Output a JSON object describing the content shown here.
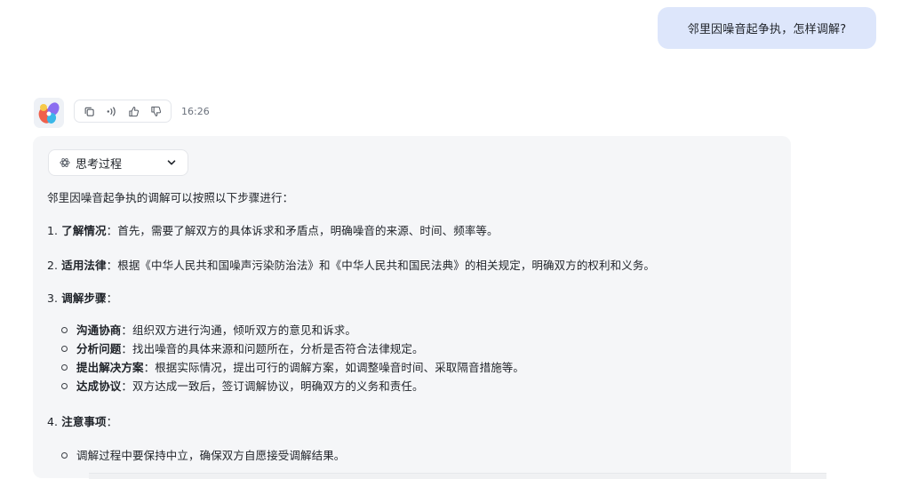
{
  "user_message": "邻里因噪音起争执，怎样调解?",
  "assistant": {
    "time": "16:26",
    "actions": [
      {
        "icon": "copy-icon",
        "name": "copy-button"
      },
      {
        "icon": "speaker-icon",
        "name": "read-aloud-button"
      },
      {
        "icon": "thumbs-up-icon",
        "name": "like-button"
      },
      {
        "icon": "thumbs-down-icon",
        "name": "dislike-button"
      }
    ],
    "thinking_label": "思考过程",
    "intro": "邻里因噪音起争执的调解可以按照以下步骤进行：",
    "items": [
      {
        "num": "1.",
        "title": "了解情况",
        "text": "：首先，需要了解双方的具体诉求和矛盾点，明确噪音的来源、时间、频率等。"
      },
      {
        "num": "2.",
        "title": "适用法律",
        "text": "：根据《中华人民共和国噪声污染防治法》和《中华人民共和国民法典》的相关规定，明确双方的权利和义务。"
      },
      {
        "num": "3.",
        "title": "调解步骤",
        "text": "："
      },
      {
        "num": "4.",
        "title": "注意事项",
        "text": "："
      }
    ],
    "steps": [
      {
        "title": "沟通协商",
        "text": "：组织双方进行沟通，倾听双方的意见和诉求。"
      },
      {
        "title": "分析问题",
        "text": "：找出噪音的具体来源和问题所在，分析是否符合法律规定。"
      },
      {
        "title": "提出解决方案",
        "text": "：根据实际情况，提出可行的调解方案，如调整噪音时间、采取隔音措施等。"
      },
      {
        "title": "达成协议",
        "text": "：双方达成一致后，签订调解协议，明确双方的义务和责任。"
      }
    ],
    "notes": [
      {
        "text": "调解过程中要保持中立，确保双方自愿接受调解结果。"
      }
    ]
  }
}
